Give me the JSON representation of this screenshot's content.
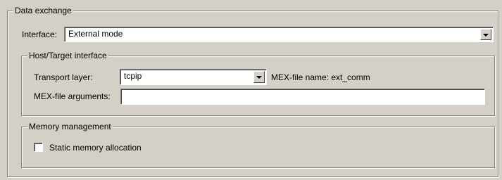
{
  "data_exchange": {
    "title": "Data exchange",
    "interface_label": "Interface:",
    "interface_value": "External mode"
  },
  "host_target": {
    "title": "Host/Target interface",
    "transport_label": "Transport layer:",
    "transport_value": "tcpip",
    "mex_file_name": "MEX-file name: ext_comm",
    "mex_args_label": "MEX-file arguments:",
    "mex_args_value": ""
  },
  "memory": {
    "title": "Memory management",
    "static_alloc_label": "Static memory allocation",
    "static_alloc_checked": false
  }
}
